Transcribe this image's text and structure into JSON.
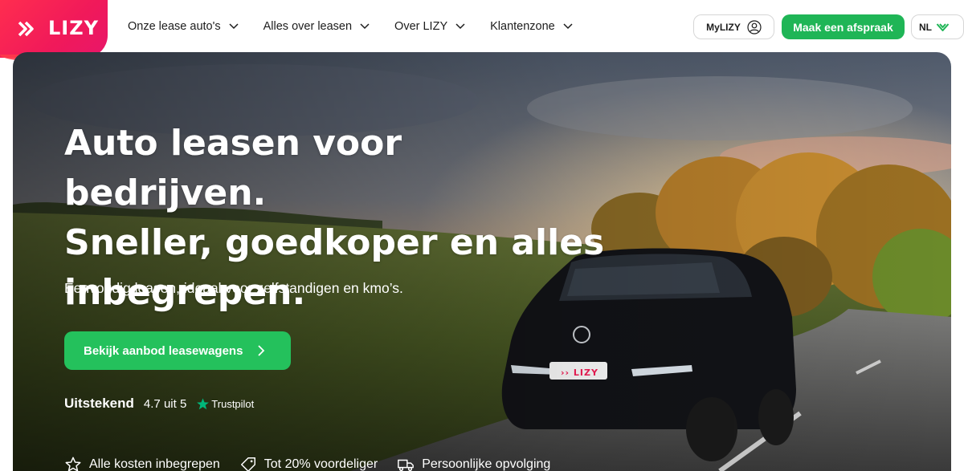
{
  "brand": {
    "name": "LIZY",
    "primary_color": "#f0195a",
    "accent_green": "#1fb556"
  },
  "nav": {
    "items": [
      {
        "label": "Onze lease auto's"
      },
      {
        "label": "Alles over leasen"
      },
      {
        "label": "Over LIZY"
      },
      {
        "label": "Klantenzone"
      }
    ],
    "mylizy_label": "MyLIZY",
    "cta_label": "Maak een afspraak",
    "language": "NL"
  },
  "hero": {
    "headline_1": "Auto leasen voor bedrijven.",
    "headline_2": "Sneller, goedkoper en alles",
    "headline_3": "inbegrepen.",
    "subline": "Eenvoudig leasen, ideaal voor zelfstandigen en kmo’s.",
    "cta_label": "Bekijk aanbod leasewagens",
    "car_plate": "LIZY",
    "rating": {
      "word": "Uitstekend",
      "score": "4.7 uit 5",
      "provider": "Trustpilot"
    },
    "usps": [
      {
        "label": "Alle kosten inbegrepen",
        "icon": "star-icon"
      },
      {
        "label": "Tot 20% voordeliger",
        "icon": "tag-icon"
      },
      {
        "label": "Persoonlijke opvolging",
        "icon": "truck-icon"
      }
    ]
  }
}
